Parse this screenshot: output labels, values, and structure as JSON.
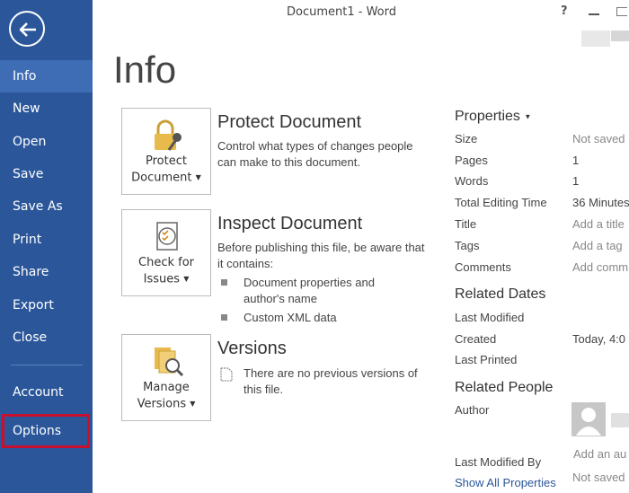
{
  "window": {
    "title": "Document1 - Word",
    "help": "?"
  },
  "nav": {
    "items": [
      "Info",
      "New",
      "Open",
      "Save",
      "Save As",
      "Print",
      "Share",
      "Export",
      "Close"
    ],
    "account": "Account",
    "options": "Options"
  },
  "page": {
    "heading": "Info"
  },
  "protect": {
    "button_line1": "Protect",
    "button_line2": "Document",
    "title": "Protect Document",
    "description": "Control what types of changes people can make to this document."
  },
  "inspect": {
    "button_line1": "Check for",
    "button_line2": "Issues",
    "title": "Inspect Document",
    "description": "Before publishing this file, be aware that it contains:",
    "bullets": [
      "Document properties and author's name",
      "Custom XML data"
    ]
  },
  "versions": {
    "button_line1": "Manage",
    "button_line2": "Versions",
    "title": "Versions",
    "description": "There are no previous versions of this file."
  },
  "properties": {
    "header": "Properties",
    "rows": [
      {
        "key": "Size",
        "value": "Not saved"
      },
      {
        "key": "Pages",
        "value": "1"
      },
      {
        "key": "Words",
        "value": "1"
      },
      {
        "key": "Total Editing Time",
        "value": "36 Minutes"
      },
      {
        "key": "Title",
        "value": "Add a title"
      },
      {
        "key": "Tags",
        "value": "Add a tag"
      },
      {
        "key": "Comments",
        "value": "Add comm"
      }
    ],
    "related_dates": {
      "header": "Related Dates",
      "rows": [
        {
          "key": "Last Modified",
          "value": ""
        },
        {
          "key": "Created",
          "value": "Today, 4:0"
        },
        {
          "key": "Last Printed",
          "value": ""
        }
      ]
    },
    "related_people": {
      "header": "Related People",
      "author_label": "Author",
      "add_author": "Add an au",
      "last_modified_by_label": "Last Modified By",
      "last_modified_by_value": "Not saved"
    },
    "show_all": "Show All Properties"
  },
  "colors": {
    "nav_bg": "#2b579a",
    "nav_active": "#3e6db5",
    "highlight": "#c8102e"
  }
}
